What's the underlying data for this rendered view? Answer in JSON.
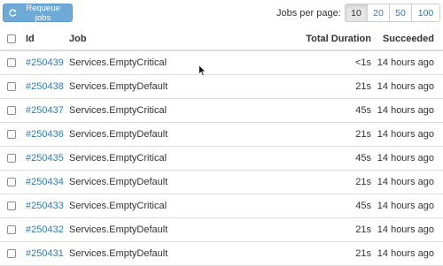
{
  "toolbar": {
    "requeue_label": "Requeue jobs",
    "requeue_icon": "refresh-icon",
    "per_page_label": "Jobs per page:",
    "per_page_options": [
      "10",
      "20",
      "50",
      "100"
    ],
    "per_page_selected": "10"
  },
  "table": {
    "columns": [
      "Id",
      "Job",
      "Total Duration",
      "Succeeded"
    ],
    "rows": [
      {
        "id": "#250439",
        "job": "Services.EmptyCritical",
        "duration": "<1s",
        "succeeded": "14 hours ago"
      },
      {
        "id": "#250438",
        "job": "Services.EmptyDefault",
        "duration": "21s",
        "succeeded": "14 hours ago"
      },
      {
        "id": "#250437",
        "job": "Services.EmptyCritical",
        "duration": "45s",
        "succeeded": "14 hours ago"
      },
      {
        "id": "#250436",
        "job": "Services.EmptyDefault",
        "duration": "21s",
        "succeeded": "14 hours ago"
      },
      {
        "id": "#250435",
        "job": "Services.EmptyCritical",
        "duration": "45s",
        "succeeded": "14 hours ago"
      },
      {
        "id": "#250434",
        "job": "Services.EmptyDefault",
        "duration": "21s",
        "succeeded": "14 hours ago"
      },
      {
        "id": "#250433",
        "job": "Services.EmptyCritical",
        "duration": "45s",
        "succeeded": "14 hours ago"
      },
      {
        "id": "#250432",
        "job": "Services.EmptyDefault",
        "duration": "21s",
        "succeeded": "14 hours ago"
      },
      {
        "id": "#250431",
        "job": "Services.EmptyDefault",
        "duration": "21s",
        "succeeded": "14 hours ago"
      }
    ]
  },
  "colors": {
    "button_bg": "#6fa9d6",
    "link": "#337ab7",
    "border": "#dddddd"
  }
}
